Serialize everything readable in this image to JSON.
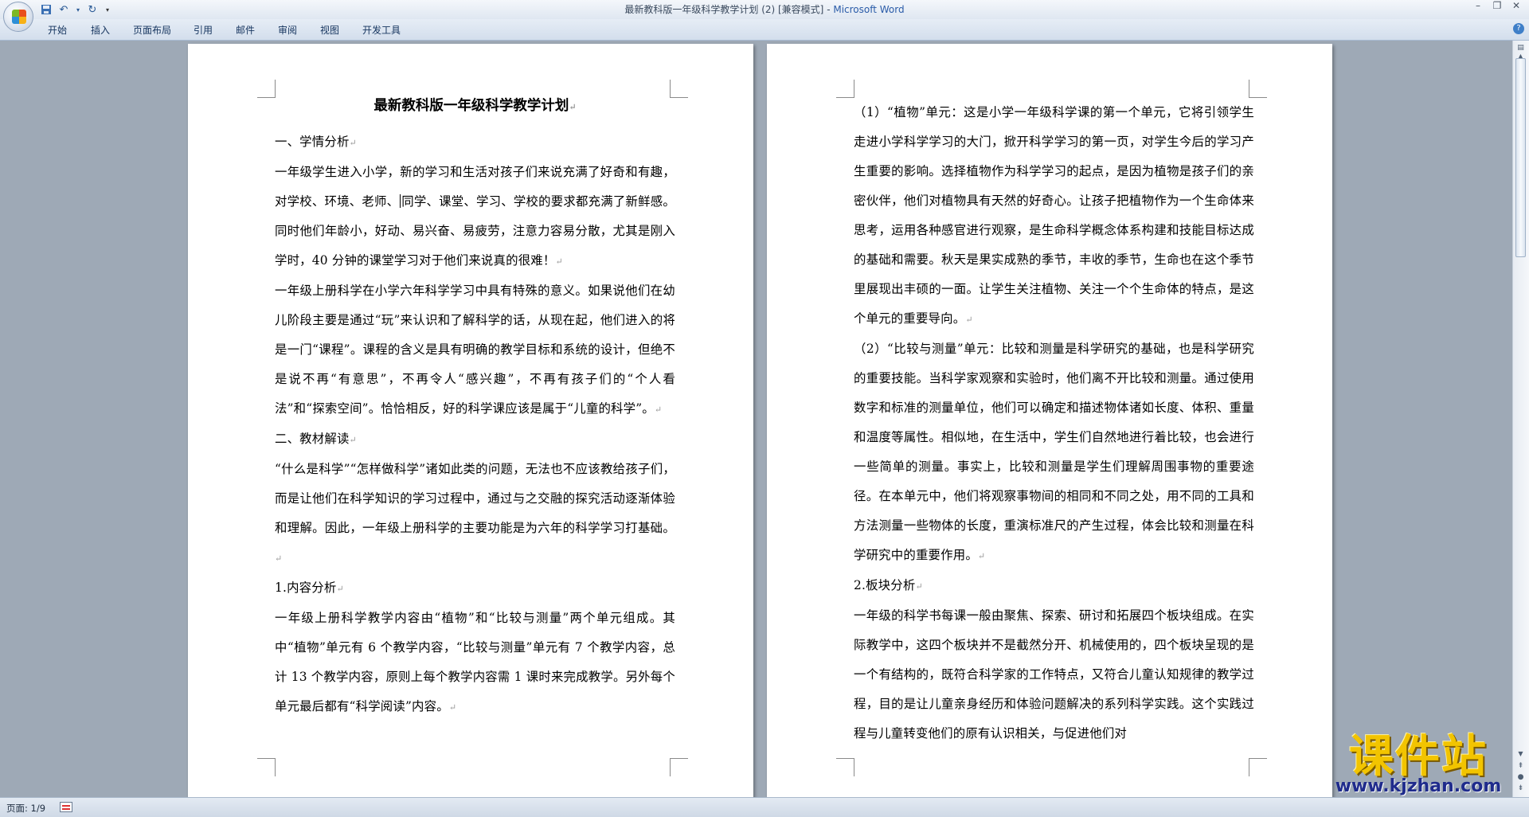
{
  "window": {
    "title": "最新教科版一年级科学教学计划 (2) [兼容模式]",
    "title_sep": " - ",
    "app": "Microsoft Word"
  },
  "ribbon": {
    "tabs": [
      "开始",
      "插入",
      "页面布局",
      "引用",
      "邮件",
      "审阅",
      "视图",
      "开发工具"
    ]
  },
  "status": {
    "page": "页面: 1/9"
  },
  "document": {
    "title": "最新教科版一年级科学教学计划",
    "page1": [
      "一、学情分析",
      "一年级学生进入小学，新的学习和生活对孩子们来说充满了好奇和有趣，对学校、环境、老师、",
      "同学、课堂、学习、学校的要求都充满了新鲜感。同时他们年龄小，好动、易兴奋、易疲劳，注意力容易分散，尤其是刚入学时，40 分钟的课堂学习对于他们来说真的很难！",
      "一年级上册科学在小学六年科学学习中具有特殊的意义。如果说他们在幼儿阶段主要是通过“玩”来认识和了解科学的话，从现在起，他们进入的将是一门“课程”。课程的含义是具有明确的教学目标和系统的设计，但绝不是说不再“有意思”，不再令人“感兴趣”，不再有孩子们的“个人看法”和“探索空间”。恰恰相反，好的科学课应该是属于“儿童的科学”。",
      "二、教材解读",
      "“什么是科学”“怎样做科学”诸如此类的问题，无法也不应该教给孩子们，而是让他们在科学知识的学习过程中，通过与之交融的探究活动逐渐体验和理解。因此，一年级上册科学的主要功能是为六年的科学学习打基础。",
      "1.内容分析",
      "一年级上册科学教学内容由“植物”和“比较与测量”两个单元组成。其中“植物”单元有 6 个教学内容，“比较与测量”单元有 7 个教学内容，总计 13 个教学内容，原则上每个教学内容需 1 课时来完成教学。另外每个单元最后都有“科学阅读”内容。"
    ],
    "page2": [
      "（1）“植物”单元：这是小学一年级科学课的第一个单元，它将引领学生走进小学科学学习的大门，掀开科学学习的第一页，对学生今后的学习产生重要的影响。选择植物作为科学学习的起点，是因为植物是孩子们的亲密伙伴，他们对植物具有天然的好奇心。让孩子把植物作为一个生命体来思考，运用各种感官进行观察，是生命科学概念体系构建和技能目标达成的基础和需要。秋天是果实成熟的季节，丰收的季节，生命也在这个季节里展现出丰硕的一面。让学生关注植物、关注一个个生命体的特点，是这个单元的重要导向。",
      "（2）“比较与测量”单元：比较和测量是科学研究的基础，也是科学研究的重要技能。当科学家观察和实验时，他们离不开比较和测量。通过使用数字和标准的测量单位，他们可以确定和描述物体诸如长度、体积、重量和温度等属性。相似地，在生活中，学生们自然地进行着比较，也会进行一些简单的测量。事实上，比较和测量是学生们理解周围事物的重要途径。在本单元中，他们将观察事物间的相同和不同之处，用不同的工具和方法测量一些物体的长度，重演标准尺的产生过程，体会比较和测量在科学研究中的重要作用。",
      "2.板块分析",
      "一年级的科学书每课一般由聚焦、探索、研讨和拓展四个板块组成。在实际教学中，这四个板块并不是截然分开、机械使用的，四个板块呈现的是一个有结构的，既符合科学家的工作特点，又符合儿童认知规律的教学过程，目的是让儿童亲身经历和体验问题解决的系列科学实践。这个实践过程与儿童转变他们的原有认识相关，与促进他们对"
    ]
  },
  "watermark": {
    "cn": "课件站",
    "url": "www.kjzhan.com"
  },
  "icons": {
    "office": "office-button-icon",
    "save": "save-icon",
    "undo": "undo-icon",
    "redo": "redo-icon",
    "qat_menu": "chevron-down-icon",
    "help": "help-icon"
  }
}
